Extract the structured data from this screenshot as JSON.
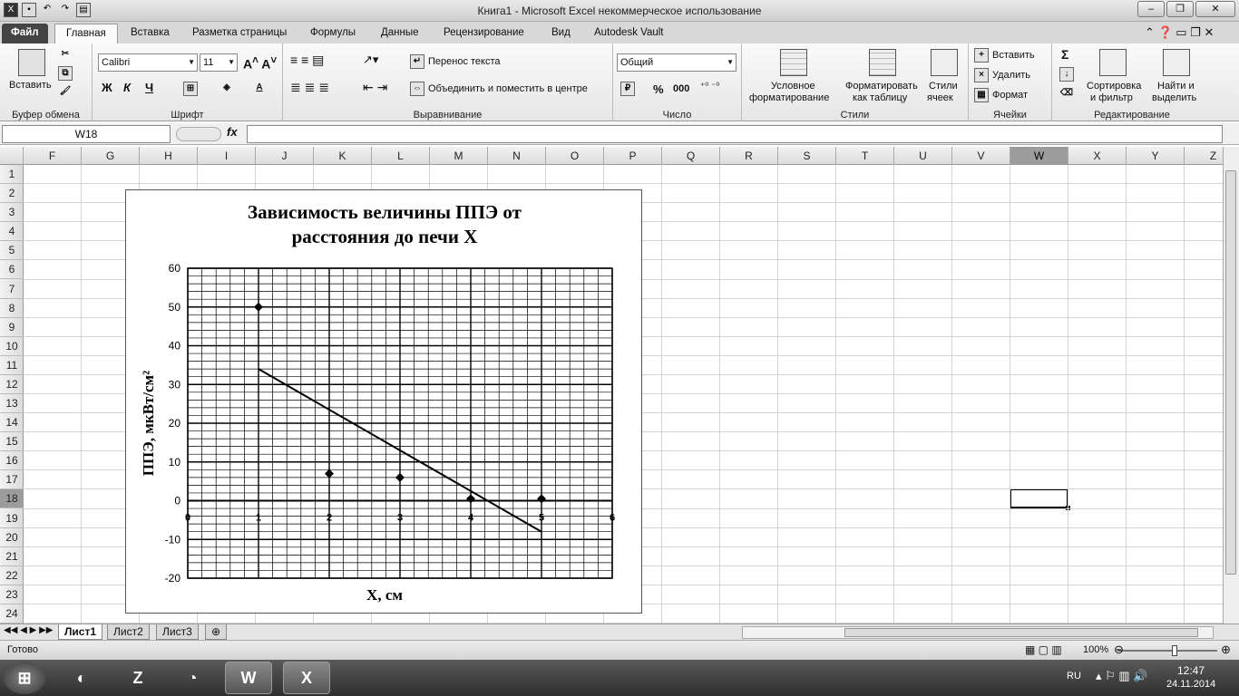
{
  "window": {
    "title": "Книга1  -  Microsoft Excel некоммерческое использование",
    "buttons": [
      "–",
      "❐",
      "✕"
    ]
  },
  "qat": [
    "save-icon",
    "undo-icon",
    "redo-icon",
    "customize-icon"
  ],
  "tabs": [
    "Файл",
    "Главная",
    "Вставка",
    "Разметка страницы",
    "Формулы",
    "Данные",
    "Рецензирование",
    "Вид",
    "Autodesk Vault"
  ],
  "ribbon": {
    "clipboard": {
      "paste": "Вставить",
      "label": "Буфер обмена"
    },
    "font": {
      "name": "Calibri",
      "size": "11",
      "bold": "Ж",
      "italic": "К",
      "underline": "Ч",
      "label": "Шрифт"
    },
    "alignment": {
      "wrap": "Перенос текста",
      "merge": "Объединить и поместить в центре",
      "label": "Выравнивание"
    },
    "number": {
      "format": "Общий",
      "percent": "%",
      "thousands": "000",
      "label": "Число"
    },
    "styles": {
      "conditional1": "Условное",
      "conditional2": "форматирование",
      "table1": "Форматировать",
      "table2": "как таблицу",
      "cell1": "Стили",
      "cell2": "ячеек",
      "label": "Стили"
    },
    "cells": {
      "insert": "Вставить",
      "delete": "Удалить",
      "format": "Формат",
      "label": "Ячейки"
    },
    "editing": {
      "sum": "Σ",
      "sort1": "Сортировка",
      "sort2": "и фильтр",
      "find1": "Найти и",
      "find2": "выделить",
      "label": "Редактирование"
    }
  },
  "formula_bar": {
    "name_box": "W18",
    "fx": "fx",
    "value": ""
  },
  "columns": [
    "F",
    "G",
    "H",
    "I",
    "J",
    "K",
    "L",
    "M",
    "N",
    "O",
    "P",
    "Q",
    "R",
    "S",
    "T",
    "U",
    "V",
    "W",
    "X",
    "Y",
    "Z"
  ],
  "rows": [
    "1",
    "2",
    "3",
    "4",
    "5",
    "6",
    "7",
    "8",
    "9",
    "10",
    "11",
    "12",
    "13",
    "14",
    "15",
    "16",
    "17",
    "18",
    "19",
    "20",
    "21",
    "22",
    "23",
    "24"
  ],
  "selected": {
    "column": "W",
    "row": "18"
  },
  "sheets": [
    "Лист1",
    "Лист2",
    "Лист3"
  ],
  "status": {
    "ready": "Готово",
    "zoom": "100%"
  },
  "taskbar": {
    "lang": "RU",
    "time": "12:47",
    "date": "24.11.2014"
  },
  "chart_data": {
    "type": "scatter",
    "title_line1": "Зависимость величины ППЭ от",
    "title_line2": "расстояния до печи Х",
    "xlabel": "Х, см",
    "ylabel": "ППЭ, мкВт/см²",
    "xlim": [
      0,
      6
    ],
    "ylim": [
      -20,
      60
    ],
    "xticks": [
      0,
      1,
      2,
      3,
      4,
      5,
      6
    ],
    "yticks": [
      -20,
      -10,
      0,
      10,
      20,
      30,
      40,
      50,
      60
    ],
    "minor_x_step": 0.2,
    "minor_y_step": 2,
    "grid": true,
    "points": [
      [
        1,
        50
      ],
      [
        2,
        7
      ],
      [
        3,
        6
      ],
      [
        4,
        0.5
      ],
      [
        5,
        0.5
      ]
    ],
    "trendline": [
      [
        1,
        34
      ],
      [
        5,
        -8
      ]
    ]
  }
}
